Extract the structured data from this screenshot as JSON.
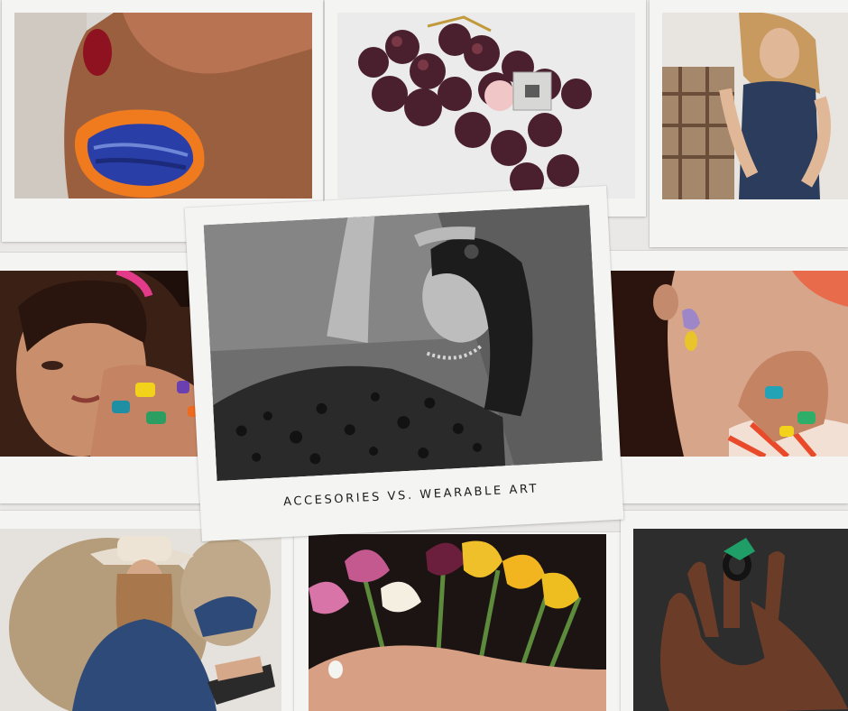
{
  "collage": {
    "caption": "ACCESORIES VS. WEARABLE ART",
    "photos": [
      {
        "subject": "hand-wearing-orange-blue-stone-ring-photo"
      },
      {
        "subject": "grapes-with-pink-orb-ring-photo"
      },
      {
        "subject": "woman-in-denim-dress-photo"
      },
      {
        "subject": "woman-with-colorful-rings-photo"
      },
      {
        "subject": "black-and-white-woman-leopard-dress-photo"
      },
      {
        "subject": "woman-with-lilac-earring-photo"
      },
      {
        "subject": "woman-in-cowboy-hat-photo"
      },
      {
        "subject": "calla-lily-bouquet-photo"
      },
      {
        "subject": "hand-holding-green-ring-photo"
      }
    ]
  }
}
